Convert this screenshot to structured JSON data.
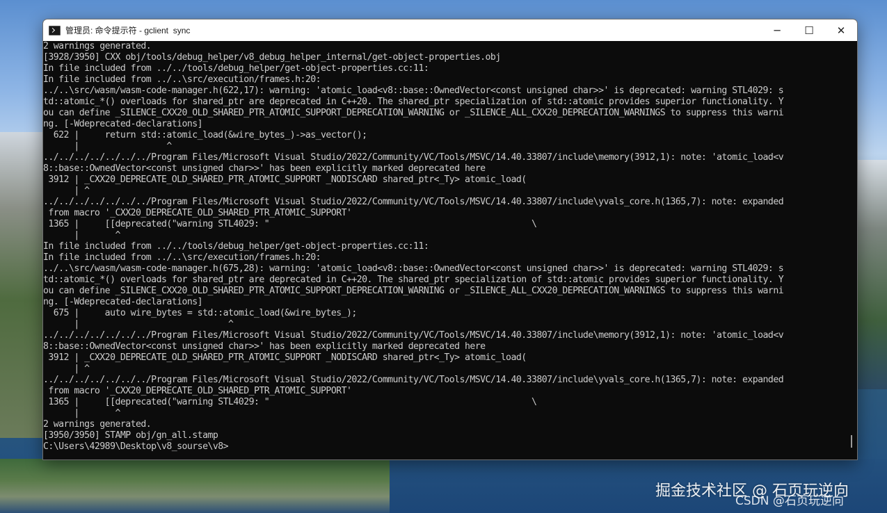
{
  "window": {
    "title": "管理员: 命令提示符 - gclient  sync",
    "controls": {
      "minimize": "─",
      "maximize": "☐",
      "close": "✕"
    }
  },
  "console": {
    "lines": [
      "2 warnings generated.",
      "[3928/3950] CXX obj/tools/debug_helper/v8_debug_helper_internal/get-object-properties.obj",
      "In file included from ../../tools/debug_helper/get-object-properties.cc:11:",
      "In file included from ../..\\src/execution/frames.h:20:",
      "../..\\src/wasm/wasm-code-manager.h(622,17): warning: 'atomic_load<v8::base::OwnedVector<const unsigned char>>' is deprecated: warning STL4029: s",
      "td::atomic_*() overloads for shared_ptr are deprecated in C++20. The shared_ptr specialization of std::atomic provides superior functionality. Y",
      "ou can define _SILENCE_CXX20_OLD_SHARED_PTR_ATOMIC_SUPPORT_DEPRECATION_WARNING or _SILENCE_ALL_CXX20_DEPRECATION_WARNINGS to suppress this warni",
      "ng. [-Wdeprecated-declarations]",
      "  622 |     return std::atomic_load(&wire_bytes_)->as_vector();",
      "      |                 ^",
      "../../../../../../../Program Files/Microsoft Visual Studio/2022/Community/VC/Tools/MSVC/14.40.33807/include\\memory(3912,1): note: 'atomic_load<v",
      "8::base::OwnedVector<const unsigned char>>' has been explicitly marked deprecated here",
      " 3912 | _CXX20_DEPRECATE_OLD_SHARED_PTR_ATOMIC_SUPPORT _NODISCARD shared_ptr<_Ty> atomic_load(",
      "      | ^",
      "../../../../../../../Program Files/Microsoft Visual Studio/2022/Community/VC/Tools/MSVC/14.40.33807/include\\yvals_core.h(1365,7): note: expanded",
      " from macro '_CXX20_DEPRECATE_OLD_SHARED_PTR_ATOMIC_SUPPORT'",
      " 1365 |     [[deprecated(\"warning STL4029: \"                                                   \\",
      "      |       ^",
      "In file included from ../../tools/debug_helper/get-object-properties.cc:11:",
      "In file included from ../..\\src/execution/frames.h:20:",
      "../..\\src/wasm/wasm-code-manager.h(675,28): warning: 'atomic_load<v8::base::OwnedVector<const unsigned char>>' is deprecated: warning STL4029: s",
      "td::atomic_*() overloads for shared_ptr are deprecated in C++20. The shared_ptr specialization of std::atomic provides superior functionality. Y",
      "ou can define _SILENCE_CXX20_OLD_SHARED_PTR_ATOMIC_SUPPORT_DEPRECATION_WARNING or _SILENCE_ALL_CXX20_DEPRECATION_WARNINGS to suppress this warni",
      "ng. [-Wdeprecated-declarations]",
      "  675 |     auto wire_bytes = std::atomic_load(&wire_bytes_);",
      "      |                             ^",
      "../../../../../../../Program Files/Microsoft Visual Studio/2022/Community/VC/Tools/MSVC/14.40.33807/include\\memory(3912,1): note: 'atomic_load<v",
      "8::base::OwnedVector<const unsigned char>>' has been explicitly marked deprecated here",
      " 3912 | _CXX20_DEPRECATE_OLD_SHARED_PTR_ATOMIC_SUPPORT _NODISCARD shared_ptr<_Ty> atomic_load(",
      "      | ^",
      "../../../../../../../Program Files/Microsoft Visual Studio/2022/Community/VC/Tools/MSVC/14.40.33807/include\\yvals_core.h(1365,7): note: expanded",
      " from macro '_CXX20_DEPRECATE_OLD_SHARED_PTR_ATOMIC_SUPPORT'",
      " 1365 |     [[deprecated(\"warning STL4029: \"                                                   \\",
      "      |       ^",
      "2 warnings generated.",
      "[3950/3950] STAMP obj/gn_all.stamp",
      "C:\\Users\\42989\\Desktop\\v8_sourse\\v8>"
    ]
  },
  "watermark": {
    "primary": "掘金技术社区 @ 石页玩逆向",
    "secondary": "CSDN @石页玩逆向"
  }
}
